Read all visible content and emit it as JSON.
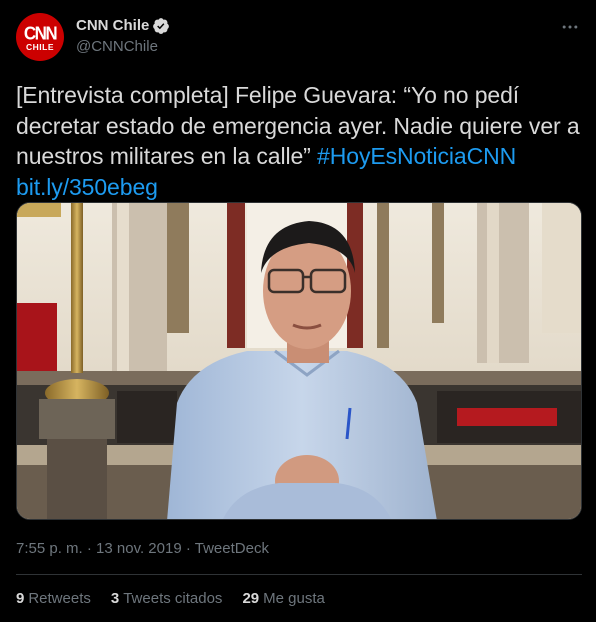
{
  "author": {
    "display_name": "CNN Chile",
    "handle": "@CNNChile",
    "avatar_text_top": "CNN",
    "avatar_text_bottom": "CHILE",
    "verified_icon": "verified-badge-icon",
    "brand_color": "#cc0000"
  },
  "tweet": {
    "text_part1": "[Entrevista completa] Felipe Guevara: “Yo no pedí decretar estado de emergencia ayer. Nadie quiere ver a nuestros militares en la calle” ",
    "hashtag": "#HoyEsNoticiaCNN",
    "link": "bit.ly/350ebeg",
    "media_icon": "video-thumbnail"
  },
  "meta": {
    "time": "7:55 p. m.",
    "separator": "·",
    "date": "13 nov. 2019",
    "source": "TweetDeck"
  },
  "stats": {
    "retweets_count": "9",
    "retweets_label": "Retweets",
    "quotes_count": "3",
    "quotes_label": "Tweets citados",
    "likes_count": "29",
    "likes_label": "Me gusta"
  },
  "colors": {
    "background": "#000000",
    "text": "#d9d9d9",
    "muted": "#6e767d",
    "link": "#1d9bf0",
    "divider": "#2f3336"
  }
}
